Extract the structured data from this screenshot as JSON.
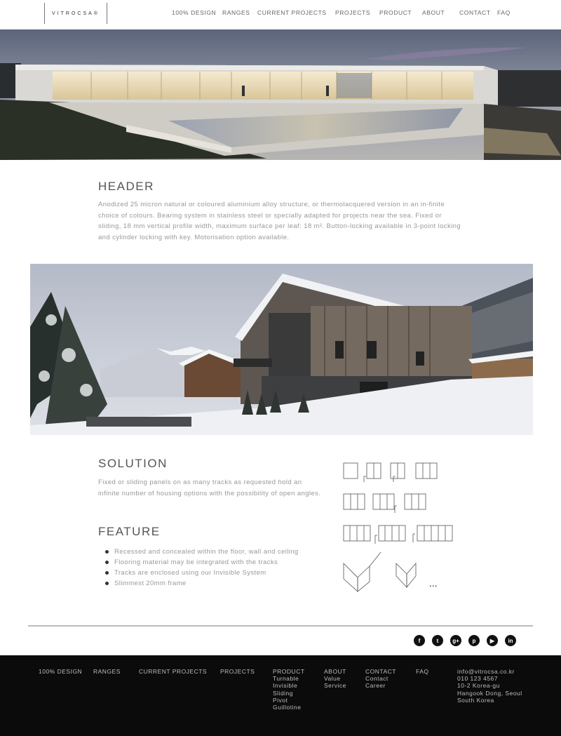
{
  "brand": {
    "logo_text": "VITROCSA®"
  },
  "nav": {
    "items": [
      "100% DESIGN",
      "RANGES",
      "CURRENT PROJECTS",
      "PROJECTS",
      "PRODUCT",
      "ABOUT",
      "CONTACT",
      "FAQ"
    ]
  },
  "header_section": {
    "title": "HEADER",
    "body": "Anodized 25 micron natural or coloured aluminium alloy structure, or thermolacquered version in an in-finite choice of colours. Bearing system in stainless steel or specially adapted for projects near the sea. Fixed or sliding, 18 mm vertical profile width, maximum surface per leaf: 18 m². Button-locking available in 3-point locking and cylinder locking with key. Motorisation option available."
  },
  "solution": {
    "title": "SOLUTION",
    "body": "Fixed or sliding panels on as many tracks as requested hold an infinite number of housing options with the possibility of open angles."
  },
  "feature": {
    "title": "FEATURE",
    "items": [
      "Recessed and concealed within the floor, wall and ceiling",
      "Flooring material may be integrated with the tracks",
      "Tracks are enclosed using our Invisible System",
      "Slimmest 20mm frame"
    ],
    "more_label": "..."
  },
  "social": [
    {
      "icon": "facebook-icon",
      "glyph": "f"
    },
    {
      "icon": "twitter-icon",
      "glyph": "t"
    },
    {
      "icon": "google-plus-icon",
      "glyph": "g+"
    },
    {
      "icon": "pinterest-icon",
      "glyph": "p"
    },
    {
      "icon": "youtube-icon",
      "glyph": "▶"
    },
    {
      "icon": "linkedin-icon",
      "glyph": "in"
    }
  ],
  "footer": {
    "design": "100% DESIGN",
    "ranges": "RANGES",
    "current_projects": "CURRENT PROJECTS",
    "projects": "PROJECTS",
    "product": {
      "title": "PRODUCT",
      "items": [
        "Turnable",
        "Invisible",
        "Sliding",
        "Pivot",
        "Guillotine"
      ]
    },
    "about": {
      "title": "ABOUT",
      "items": [
        "Value",
        "Service"
      ]
    },
    "contact": {
      "title": "CONTACT",
      "items": [
        "Contact",
        "Career"
      ]
    },
    "faq": "FAQ",
    "info": [
      "info@vitrocsa.co.kr",
      "010 123 4567",
      "10-2 Korea-gu",
      "Hangook Dong, Seoul",
      "South Korea"
    ]
  }
}
